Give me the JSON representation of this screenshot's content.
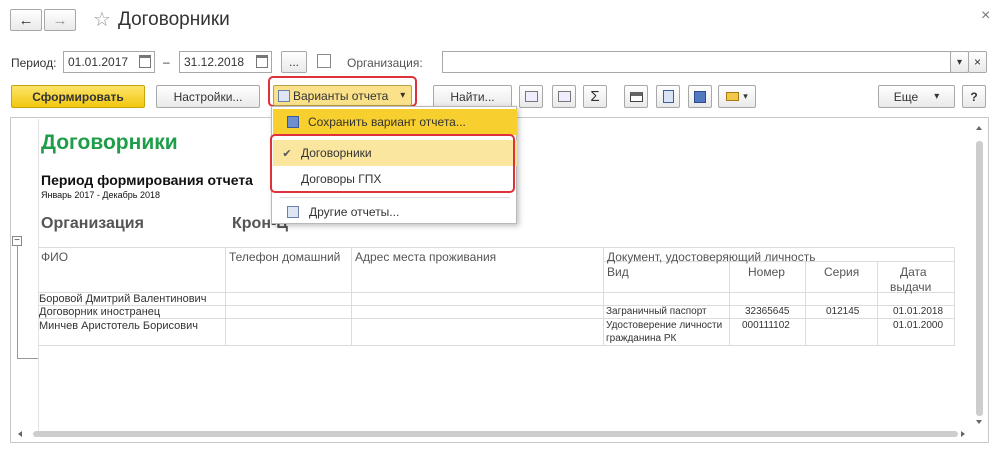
{
  "window": {
    "title": "Договорники"
  },
  "nav": {
    "back": "←",
    "forward": "→",
    "star": "☆",
    "close": "×"
  },
  "filters": {
    "period_label": "Период:",
    "date_from": "01.01.2017",
    "dash": "–",
    "date_to": "31.12.2018",
    "more": "...",
    "org_label": "Организация:",
    "org_value": "",
    "org_dropdown": "▾",
    "org_clear": "×"
  },
  "toolbar": {
    "generate": "Сформировать",
    "settings": "Настройки...",
    "variants": "Варианты отчета",
    "variants_arrow": "▾",
    "find": "Найти...",
    "sigma": "Σ",
    "more": "Еще",
    "more_arrow": "▾",
    "help": "?"
  },
  "menu": {
    "save_variant": "Сохранить вариант отчета...",
    "items": [
      {
        "label": "Договорники",
        "checked": "✔"
      },
      {
        "label": "Договоры ГПХ",
        "checked": ""
      }
    ],
    "other_reports": "Другие отчеты..."
  },
  "report": {
    "title": "Договорники",
    "period_heading": "Период формирования отчета",
    "period_value": "Январь 2017 - Декабрь 2018",
    "org_label": "Организация",
    "org_name": "Крон-Ц",
    "columns": {
      "fio": "ФИО",
      "phone": "Телефон домашний",
      "address": "Адрес места проживания",
      "document": "Документ, удостоверяющий личность",
      "kind": "Вид",
      "number": "Номер",
      "series": "Серия",
      "date": "Дата",
      "date2": "выдачи"
    },
    "rows": [
      {
        "fio": "Боровой Дмитрий Валентинович",
        "kind": "",
        "kind2": "",
        "number": "",
        "series": "",
        "date": ""
      },
      {
        "fio": "Договорник иностранец",
        "kind": "Заграничный паспорт",
        "kind2": "",
        "number": "32365645",
        "series": "012145",
        "date": "01.01.2018"
      },
      {
        "fio": "Минчев Аристотель Борисович",
        "kind": "Удостоверение личности",
        "kind2": "гражданина РК",
        "number": "000111102",
        "series": "",
        "date": "01.01.2000"
      }
    ]
  },
  "colors": {
    "accent_yellow": "#f6d126",
    "title_green": "#1e9e49",
    "highlight_red": "#e0313a",
    "menu_hover": "#fbe28a"
  }
}
